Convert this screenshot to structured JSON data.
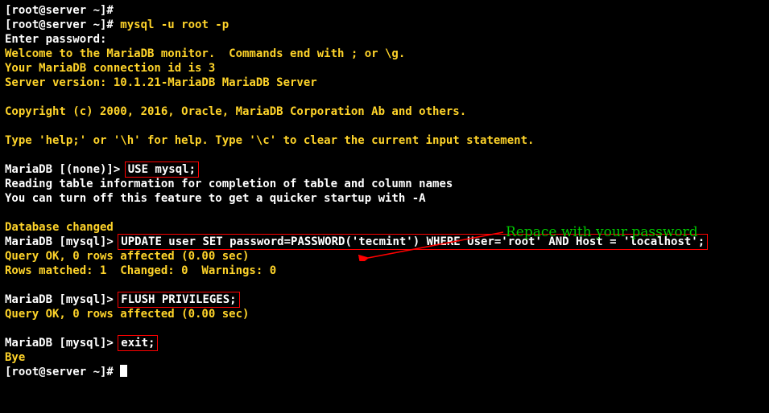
{
  "prompt1": "[root@server ~]#",
  "prompt2": "[root@server ~]# ",
  "cmd_mysql": "mysql -u root -p",
  "enter_pw": "Enter password:",
  "welcome1": "Welcome to the MariaDB monitor.  Commands end with ; or \\g.",
  "welcome2": "Your MariaDB connection id is 3",
  "welcome3": "Server version: 10.1.21-MariaDB MariaDB Server",
  "copyright": "Copyright (c) 2000, 2016, Oracle, MariaDB Corporation Ab and others.",
  "help": "Type 'help;' or '\\h' for help. Type '\\c' to clear the current input statement.",
  "mdb_none": "MariaDB [(none)]> ",
  "use_mysql": "USE mysql;",
  "reading1": "Reading table information for completion of table and column names",
  "reading2": "You can turn off this feature to get a quicker startup with -A",
  "db_changed": "Database changed",
  "mdb_mysql": "MariaDB [mysql]> ",
  "update_sql": "UPDATE user SET password=PASSWORD('tecmint') WHERE User='root' AND Host = 'localhost';",
  "query_ok": "Query OK, 0 rows affected (0.00 sec)",
  "rows_matched": "Rows matched: 1  Changed: 0  Warnings: 0",
  "flush": "FLUSH PRIVILEGES;",
  "exit": "exit;",
  "bye": "Bye",
  "annotation_text": "Repace with your password",
  "colors": {
    "fg_primary": "#ffffff",
    "fg_accent": "#ffd42a",
    "box_border": "#ff0000",
    "annotation": "#00c800",
    "bg": "#000000"
  }
}
